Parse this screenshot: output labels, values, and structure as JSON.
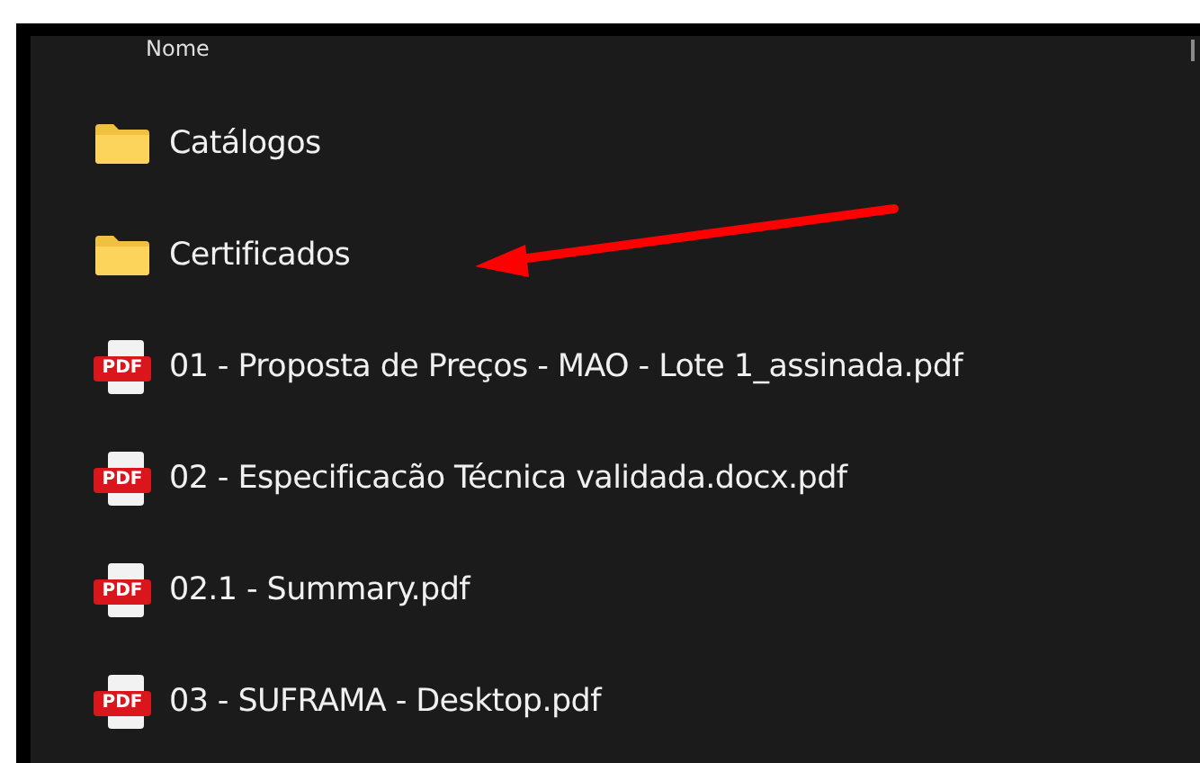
{
  "header": {
    "column_1": "Nome"
  },
  "items": [
    {
      "kind": "folder",
      "name": "Catálogos"
    },
    {
      "kind": "folder",
      "name": "Certificados"
    },
    {
      "kind": "pdf",
      "name": "01 - Proposta de Preços - MAO - Lote 1_assinada.pdf",
      "icon_label": "PDF"
    },
    {
      "kind": "pdf",
      "name": "02 - Especificacão Técnica validada.docx.pdf",
      "icon_label": "PDF"
    },
    {
      "kind": "pdf",
      "name": "02.1 - Summary.pdf",
      "icon_label": "PDF"
    },
    {
      "kind": "pdf",
      "name": "03 - SUFRAMA - Desktop.pdf",
      "icon_label": "PDF"
    }
  ]
}
